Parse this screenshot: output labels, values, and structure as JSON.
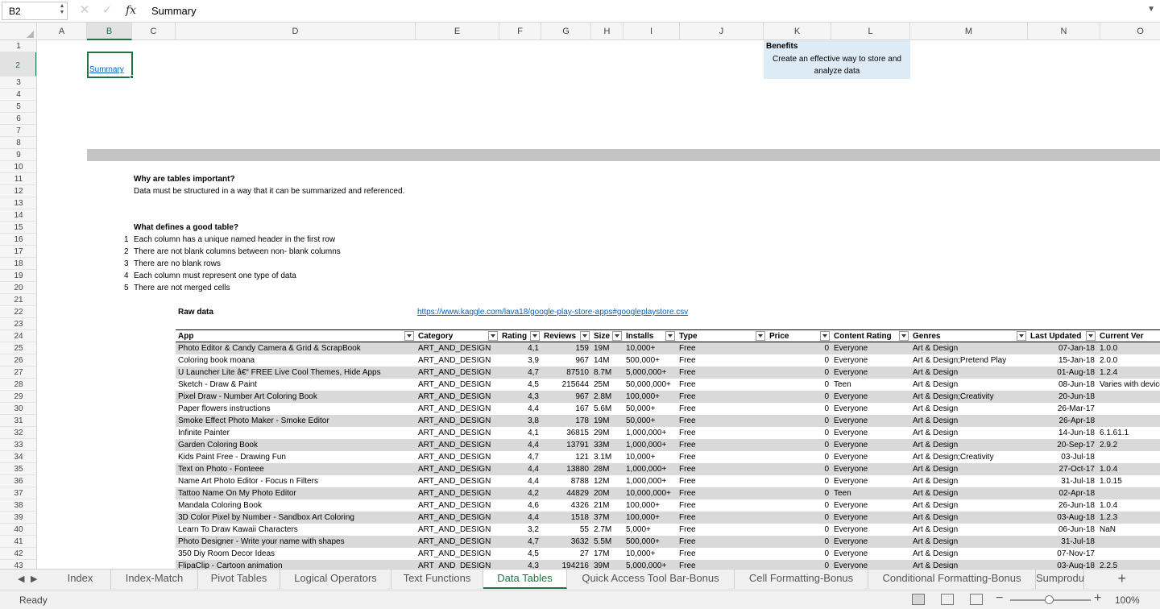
{
  "formula_bar": {
    "name_box": "B2",
    "cancel_icon": "✕",
    "enter_icon": "✓",
    "fx_label": "fx",
    "value": "Summary"
  },
  "columns": [
    "A",
    "B",
    "C",
    "D",
    "E",
    "F",
    "G",
    "H",
    "I",
    "J",
    "K",
    "L",
    "M",
    "N",
    "O"
  ],
  "selected_column": "B",
  "selected_row": 2,
  "rows": [
    1,
    2,
    3,
    4,
    5,
    6,
    7,
    8,
    9,
    10,
    11,
    12,
    13,
    14,
    15,
    16,
    17,
    18,
    19,
    20,
    21,
    22,
    23,
    24,
    25,
    26,
    27,
    28,
    29,
    30,
    31,
    32,
    33,
    34,
    35,
    36,
    37,
    38,
    39,
    40,
    41,
    42,
    43
  ],
  "content": {
    "summary_link": "Summary",
    "benefits_title": "Benefits",
    "benefits_text": "Create an effective way to store and analyze data",
    "why_title": "Why are tables important?",
    "why_text": "Data must be structured in a way that it can be summarized and referenced.",
    "define_title": "What defines a good table?",
    "rules": [
      {
        "num": "1",
        "text": "Each column has a unique named header in the first row"
      },
      {
        "num": "2",
        "text": "There are not blank columns between non- blank columns"
      },
      {
        "num": "3",
        "text": "There are no blank rows"
      },
      {
        "num": "4",
        "text": "Each column must represent one type of data"
      },
      {
        "num": "5",
        "text": "There are not merged cells"
      }
    ],
    "raw_data_label": "Raw data",
    "raw_data_link": "https://www.kaggle.com/lava18/google-play-store-apps#googleplaystore.csv"
  },
  "table": {
    "headers": [
      "App",
      "Category",
      "Rating",
      "Reviews",
      "Size",
      "Installs",
      "Type",
      "Price",
      "Content Rating",
      "Genres",
      "Last Updated",
      "Current Ver"
    ],
    "rows": [
      [
        "Photo Editor & Candy Camera & Grid & ScrapBook",
        "ART_AND_DESIGN",
        "4,1",
        "159",
        "19M",
        "10,000+",
        "Free",
        "0",
        "Everyone",
        "Art & Design",
        "07-Jan-18",
        "1.0.0"
      ],
      [
        "Coloring book moana",
        "ART_AND_DESIGN",
        "3,9",
        "967",
        "14M",
        "500,000+",
        "Free",
        "0",
        "Everyone",
        "Art & Design;Pretend Play",
        "15-Jan-18",
        "2.0.0"
      ],
      [
        "U Launcher Lite â€“ FREE Live Cool Themes, Hide Apps",
        "ART_AND_DESIGN",
        "4,7",
        "87510",
        "8.7M",
        "5,000,000+",
        "Free",
        "0",
        "Everyone",
        "Art & Design",
        "01-Aug-18",
        "1.2.4"
      ],
      [
        "Sketch - Draw & Paint",
        "ART_AND_DESIGN",
        "4,5",
        "215644",
        "25M",
        "50,000,000+",
        "Free",
        "0",
        "Teen",
        "Art & Design",
        "08-Jun-18",
        "Varies with device"
      ],
      [
        "Pixel Draw - Number Art Coloring Book",
        "ART_AND_DESIGN",
        "4,3",
        "967",
        "2.8M",
        "100,000+",
        "Free",
        "0",
        "Everyone",
        "Art & Design;Creativity",
        "20-Jun-18",
        ""
      ],
      [
        "Paper flowers instructions",
        "ART_AND_DESIGN",
        "4,4",
        "167",
        "5.6M",
        "50,000+",
        "Free",
        "0",
        "Everyone",
        "Art & Design",
        "26-Mar-17",
        ""
      ],
      [
        "Smoke Effect Photo Maker - Smoke Editor",
        "ART_AND_DESIGN",
        "3,8",
        "178",
        "19M",
        "50,000+",
        "Free",
        "0",
        "Everyone",
        "Art & Design",
        "26-Apr-18",
        ""
      ],
      [
        "Infinite Painter",
        "ART_AND_DESIGN",
        "4,1",
        "36815",
        "29M",
        "1,000,000+",
        "Free",
        "0",
        "Everyone",
        "Art & Design",
        "14-Jun-18",
        "6.1.61.1"
      ],
      [
        "Garden Coloring Book",
        "ART_AND_DESIGN",
        "4,4",
        "13791",
        "33M",
        "1,000,000+",
        "Free",
        "0",
        "Everyone",
        "Art & Design",
        "20-Sep-17",
        "2.9.2"
      ],
      [
        "Kids Paint Free - Drawing Fun",
        "ART_AND_DESIGN",
        "4,7",
        "121",
        "3.1M",
        "10,000+",
        "Free",
        "0",
        "Everyone",
        "Art & Design;Creativity",
        "03-Jul-18",
        ""
      ],
      [
        "Text on Photo - Fonteee",
        "ART_AND_DESIGN",
        "4,4",
        "13880",
        "28M",
        "1,000,000+",
        "Free",
        "0",
        "Everyone",
        "Art & Design",
        "27-Oct-17",
        "1.0.4"
      ],
      [
        "Name Art Photo Editor - Focus n Filters",
        "ART_AND_DESIGN",
        "4,4",
        "8788",
        "12M",
        "1,000,000+",
        "Free",
        "0",
        "Everyone",
        "Art & Design",
        "31-Jul-18",
        "1.0.15"
      ],
      [
        "Tattoo Name On My Photo Editor",
        "ART_AND_DESIGN",
        "4,2",
        "44829",
        "20M",
        "10,000,000+",
        "Free",
        "0",
        "Teen",
        "Art & Design",
        "02-Apr-18",
        ""
      ],
      [
        "Mandala Coloring Book",
        "ART_AND_DESIGN",
        "4,6",
        "4326",
        "21M",
        "100,000+",
        "Free",
        "0",
        "Everyone",
        "Art & Design",
        "26-Jun-18",
        "1.0.4"
      ],
      [
        "3D Color Pixel by Number - Sandbox Art Coloring",
        "ART_AND_DESIGN",
        "4,4",
        "1518",
        "37M",
        "100,000+",
        "Free",
        "0",
        "Everyone",
        "Art & Design",
        "03-Aug-18",
        "1.2.3"
      ],
      [
        "Learn To Draw Kawaii Characters",
        "ART_AND_DESIGN",
        "3,2",
        "55",
        "2.7M",
        "5,000+",
        "Free",
        "0",
        "Everyone",
        "Art & Design",
        "06-Jun-18",
        "NaN"
      ],
      [
        "Photo Designer - Write your name with shapes",
        "ART_AND_DESIGN",
        "4,7",
        "3632",
        "5.5M",
        "500,000+",
        "Free",
        "0",
        "Everyone",
        "Art & Design",
        "31-Jul-18",
        ""
      ],
      [
        "350 Diy Room Decor Ideas",
        "ART_AND_DESIGN",
        "4,5",
        "27",
        "17M",
        "10,000+",
        "Free",
        "0",
        "Everyone",
        "Art & Design",
        "07-Nov-17",
        ""
      ],
      [
        "FlipaClip - Cartoon animation",
        "ART_AND_DESIGN",
        "4,3",
        "194216",
        "39M",
        "5,000,000+",
        "Free",
        "0",
        "Everyone",
        "Art & Design",
        "03-Aug-18",
        "2.2.5"
      ]
    ]
  },
  "sheet_tabs": [
    "Index",
    "Index-Match",
    "Pivot Tables",
    "Logical Operators",
    "Text Functions",
    "Data Tables",
    "Quick Access Tool Bar-Bonus",
    "Cell Formatting-Bonus",
    "Conditional Formatting-Bonus",
    "Sumproduct"
  ],
  "active_tab": "Data Tables",
  "status": {
    "text": "Ready",
    "zoom": "100%",
    "zoom_level": 1.0
  }
}
